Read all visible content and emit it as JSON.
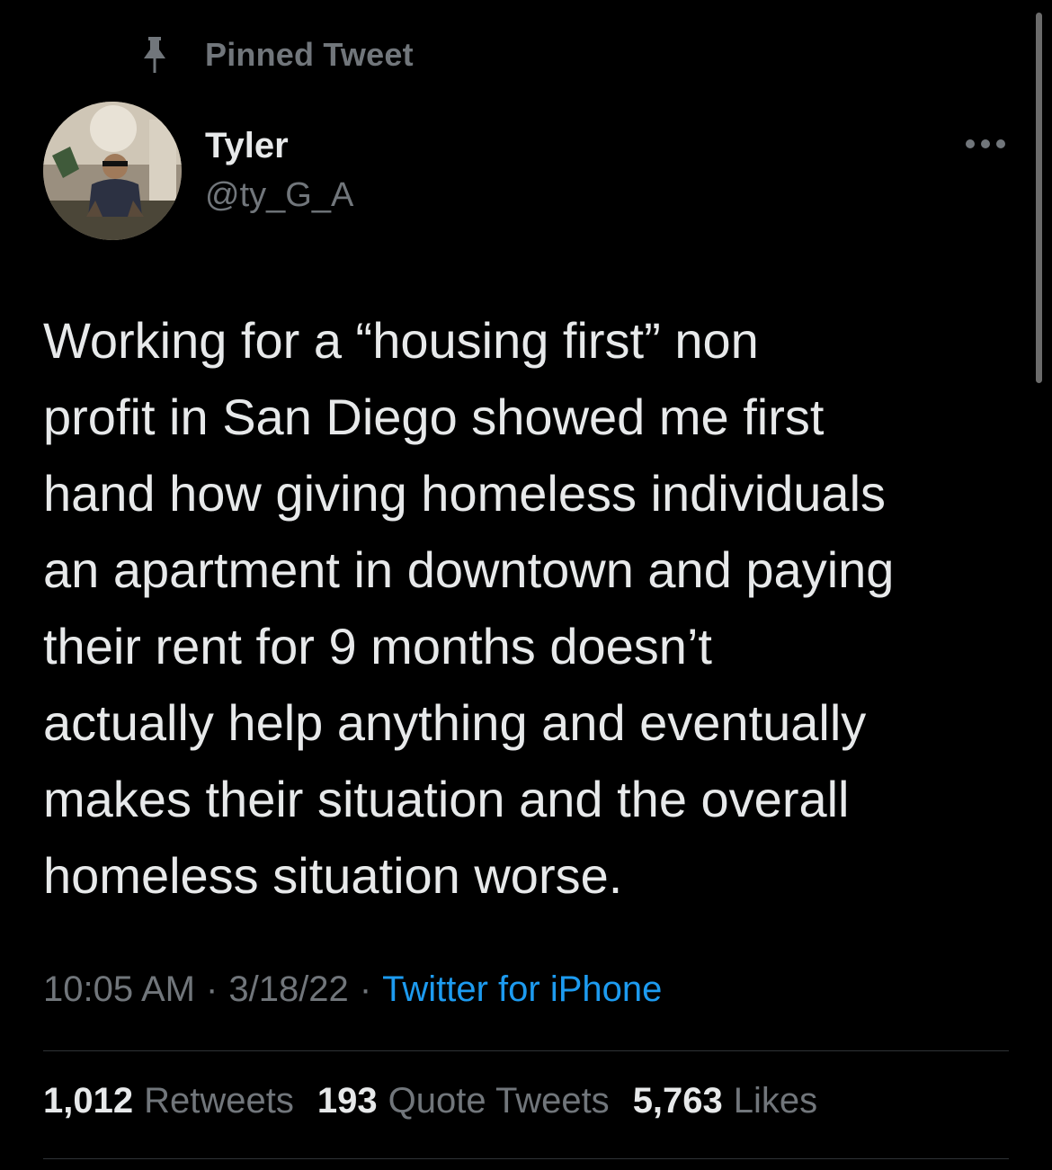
{
  "pinned": {
    "label": "Pinned Tweet",
    "icon": "pin-icon"
  },
  "author": {
    "name": "Tyler",
    "handle": "@ty_G_A",
    "avatar_icon": "avatar"
  },
  "more_icon": "more-dots-icon",
  "tweet": {
    "text": "Working for a “housing first” non\nprofit in San Diego showed me first\nhand how giving homeless individuals\nan apartment in downtown and paying\ntheir rent for 9 months doesn’t\nactually help anything and eventually\nmakes their situation and the overall\nhomeless situation worse."
  },
  "meta": {
    "time": "10:05 AM",
    "date": "3/18/22",
    "separator": "·",
    "source": "Twitter for iPhone"
  },
  "stats": {
    "retweets_count": "1,012",
    "retweets_label": "Retweets",
    "quotes_count": "193",
    "quotes_label": "Quote Tweets",
    "likes_count": "5,763",
    "likes_label": "Likes"
  },
  "colors": {
    "background": "#000000",
    "text_primary": "#e7e9ea",
    "text_secondary": "#71767b",
    "link": "#1d9bf0",
    "divider": "#2f3336"
  }
}
